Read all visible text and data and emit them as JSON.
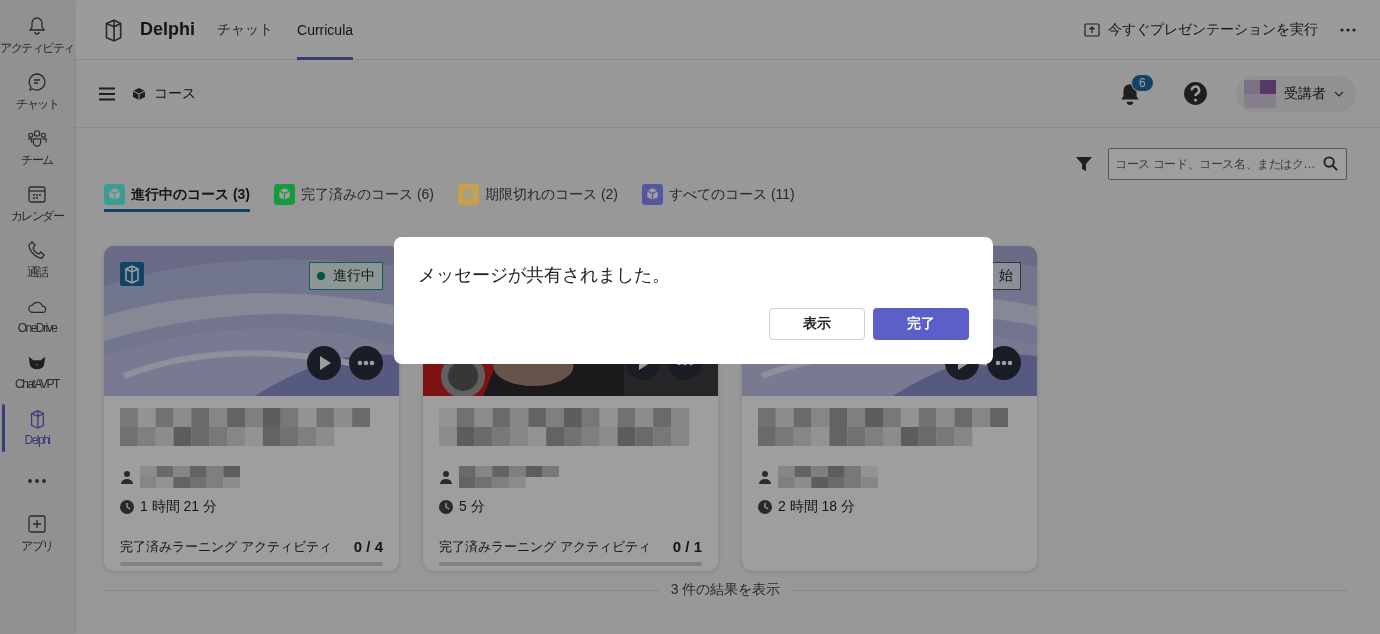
{
  "rail": {
    "items": [
      {
        "kind": "bell",
        "label": "アクティビティ",
        "selected": false
      },
      {
        "kind": "chat",
        "label": "チャット",
        "selected": false
      },
      {
        "kind": "team",
        "label": "チーム",
        "selected": false
      },
      {
        "kind": "calendar",
        "label": "カレンダー",
        "selected": false
      },
      {
        "kind": "call",
        "label": "通話",
        "selected": false
      },
      {
        "kind": "cloud",
        "label": "OneDrive",
        "selected": false
      },
      {
        "kind": "cat",
        "label": "ChatAVPT",
        "selected": false
      },
      {
        "kind": "app",
        "label": "Delphi",
        "selected": true
      },
      {
        "kind": "more",
        "selected": false
      },
      {
        "kind": "plus",
        "label": "アプリ",
        "selected": false
      }
    ]
  },
  "header": {
    "app_name": "Delphi",
    "tabs": [
      {
        "label": "チャット",
        "selected": false
      },
      {
        "label": "Curricula",
        "selected": true
      }
    ],
    "present_button": "今すぐプレゼンテーションを実行"
  },
  "toolbar": {
    "title": "コース",
    "notification_count": "6",
    "user_role": "受講者"
  },
  "search": {
    "placeholder": "コース コード、コース名、またはク…"
  },
  "course_tabs": [
    {
      "label": "進行中のコース (3)",
      "selected": true,
      "color": "#3a9d94"
    },
    {
      "label": "完了済みのコース (6)",
      "selected": false,
      "color": "#169a3e"
    },
    {
      "label": "期限切れのコース (2)",
      "selected": false,
      "color": "#c9a04a"
    },
    {
      "label": "すべてのコース (11)",
      "selected": false,
      "color": "#54579f"
    }
  ],
  "cards": [
    {
      "app_badge": true,
      "status": {
        "kind": "in_progress",
        "label": "進行中"
      },
      "duration": "1 時間 21 分",
      "progress": {
        "label": "完了済みラーニング アクティビティ",
        "count": "0 / 4",
        "level": 0
      }
    },
    {
      "duration": "5 分",
      "progress": {
        "label": "完了済みラーニング アクティビティ",
        "count": "0 / 1",
        "level": 0
      }
    },
    {
      "status": {
        "kind": "not_started",
        "label": "始"
      },
      "duration": "2 時間 18 分"
    }
  ],
  "results": "3 件の結果を表示",
  "dialog": {
    "message": "メッセージが共有されました。",
    "buttons": [
      {
        "kind": "secondary",
        "label": "表示"
      },
      {
        "kind": "primary",
        "label": "完了"
      }
    ]
  }
}
